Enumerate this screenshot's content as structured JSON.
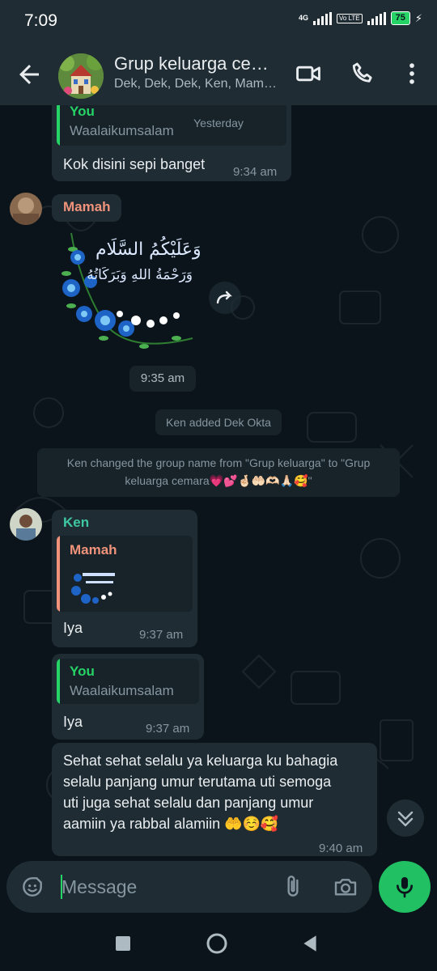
{
  "status_bar": {
    "time": "7:09",
    "network": "4G",
    "volte": "Vo LTE",
    "battery": "75"
  },
  "header": {
    "title": "Grup keluarga ce…",
    "subtitle": "Dek, Dek, Dek, Ken, Mam…"
  },
  "messages": {
    "date_pill": "Yesterday",
    "m1": {
      "quote_sender": "You",
      "quote_text": "Waalaikumsalam",
      "text": "Kok disini sepi banget",
      "time": "9:34 am"
    },
    "m2": {
      "sender": "Mamah",
      "sticker_line1": "وَعَلَيْكُمُ السَّلَام",
      "sticker_line2": "وَرَحْمَةُ اللهِ وَبَرَكَاتُهُ",
      "time": "9:35 am"
    },
    "sys1": "Ken added Dek Okta",
    "sys2_line1": "Ken changed the group name from \"Grup keluarga\" to \"Grup",
    "sys2_line2": "keluarga cemara💗💕🤞🏻🤲🏻🫶🏻🙏🏻🥰\"",
    "m3": {
      "sender": "Ken",
      "quote_sender": "Mamah",
      "text": "Iya",
      "time": "9:37 am"
    },
    "m4": {
      "quote_sender": "You",
      "quote_text": "Waalaikumsalam",
      "text": "Iya",
      "time": "9:37 am"
    },
    "m5": {
      "line1": "Sehat sehat selalu ya keluarga ku bahagia",
      "line2": "selalu panjang umur terutama uti semoga",
      "line3": "uti juga sehat selalu dan panjang umur",
      "line4": "aamiin ya rabbal alamiin 🤲☺️🥰",
      "time": "9:40 am"
    }
  },
  "composer": {
    "placeholder": "Message"
  },
  "colors": {
    "accent": "#25d366",
    "bubble": "#1f2c34",
    "sender_mamah": "#f0937a",
    "sender_ken": "#3ec8a0",
    "quote_you": "#25d366",
    "quote_mamah": "#f0937a"
  }
}
